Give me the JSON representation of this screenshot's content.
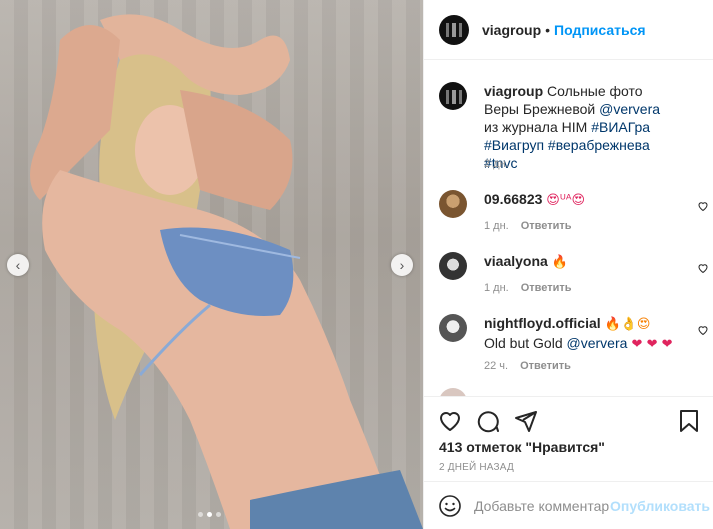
{
  "post": {
    "image_alt": "Photo",
    "carousel": {
      "total": 3,
      "active": 1
    }
  },
  "header": {
    "username": "viagroup",
    "separator": "•",
    "follow_label": "Подписаться"
  },
  "caption": {
    "username": "viagroup",
    "text_1": "Сольные фото Веры Брежневой ",
    "mention": "@ververa",
    "text_2": " из журнала HIM ",
    "hashtags": "#ВИАГра #Виагруп #верабрежнева #tnvc",
    "time": "2 дн."
  },
  "comments": [
    {
      "username": "09.66823",
      "text": "😍ᵁᴬ😍",
      "time": "1 дн.",
      "reply": "Ответить"
    },
    {
      "username": "viaalyona",
      "text": "🔥",
      "time": "1 дн.",
      "reply": "Ответить"
    },
    {
      "username": "nightfloyd.official",
      "emoji_lead": "🔥👌😍",
      "text": " Old but Gold ",
      "mention": "@ververa",
      "emoji_tail": " ❤ ❤ ❤",
      "time": "22 ч.",
      "reply": "Ответить"
    }
  ],
  "actions": {
    "likes": "413 отметок \"Нравится\"",
    "date": "2 ДНЕЙ НАЗАД"
  },
  "comment_box": {
    "placeholder": "Добавьте комментарий...",
    "post_label": "Опубликовать"
  },
  "colors": {
    "accent": "#0095f6",
    "text": "#262626",
    "muted": "#8e8e8e",
    "post_disabled": "#b2dffc"
  },
  "icons": [
    "like-icon",
    "comment-icon",
    "share-icon",
    "bookmark-icon",
    "emoji-icon",
    "heart-small-icon",
    "chevron-left-icon",
    "chevron-right-icon"
  ]
}
